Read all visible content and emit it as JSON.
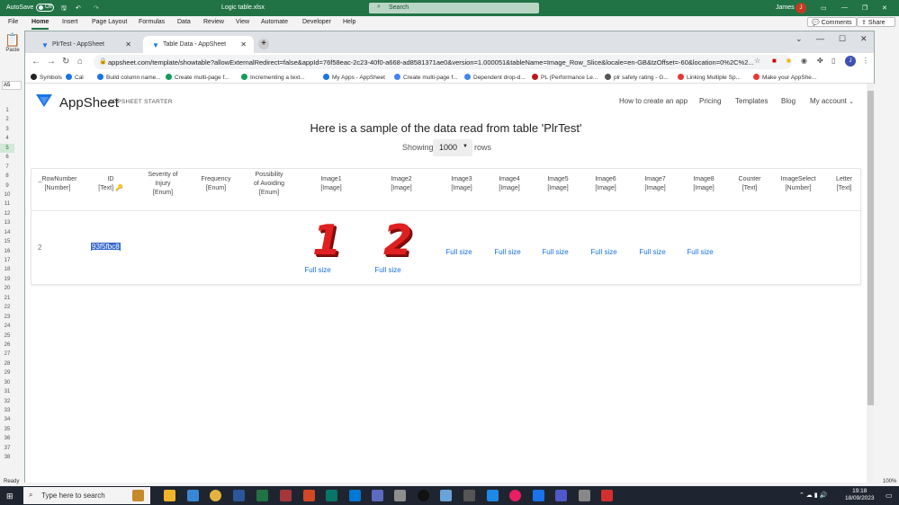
{
  "excel": {
    "autosave_label": "AutoSave",
    "autosave_state": "Off",
    "filename": "Logic table.xlsx",
    "search_placeholder": "Search",
    "user_name": "James",
    "user_initial": "J",
    "ribbon_tabs": [
      "File",
      "Home",
      "Insert",
      "Page Layout",
      "Formulas",
      "Data",
      "Review",
      "View",
      "Automate",
      "Developer",
      "Help"
    ],
    "active_tab": "Home",
    "comments_label": "Comments",
    "share_label": "Share",
    "paste_label": "Paste",
    "namebox": "A5",
    "row_numbers": [
      "1",
      "2",
      "3",
      "4",
      "5",
      "6",
      "7",
      "8",
      "9",
      "10",
      "11",
      "12",
      "13",
      "14",
      "15",
      "16",
      "17",
      "18",
      "19",
      "20",
      "21",
      "22",
      "23",
      "24",
      "25",
      "26",
      "27",
      "28",
      "29",
      "30",
      "31",
      "32",
      "33",
      "34",
      "35",
      "36",
      "37",
      "38"
    ],
    "status_left": "Ready",
    "zoom": "100%"
  },
  "chrome": {
    "tabs": [
      {
        "label": "PlrTest - AppSheet",
        "active": false
      },
      {
        "label": "Table Data - AppSheet",
        "active": true
      }
    ],
    "url": "appsheet.com/template/showtable?allowExternalRedirect=false&appId=76f58eac-2c23-40f0-a668-ad8581371ae0&version=1.000051&tableName=Image_Row_Slice&locale=en-GB&tzOffset=-60&location=0%2C%2...",
    "bookmarks": [
      "Symbols",
      "Cal",
      "Build column name...",
      "Create multi-page f...",
      "Incrementing a text...",
      "My Apps - AppSheet",
      "Create multi-page f...",
      "Dependent drop-d...",
      "PL (Performance Le...",
      "plr safety rating - G...",
      "Linking Multiple Sp...",
      "Make your AppShe..."
    ]
  },
  "appsheet": {
    "brand": "AppSheet",
    "tagline": "APPSHEET STARTER",
    "nav": [
      "How to create an app",
      "Pricing",
      "Templates",
      "Blog",
      "My account"
    ],
    "heading": "Here is a sample of the data read from table 'PlrTest'",
    "showing_label": "Showing",
    "rows_value": "1000",
    "rows_label": "rows",
    "columns": [
      {
        "name": "_RowNumber",
        "type": "[Number]"
      },
      {
        "name": "ID",
        "type": "[Text] 🔑"
      },
      {
        "name": "Severity of|Injury",
        "type": "[Enum]"
      },
      {
        "name": "Frequency",
        "type": "[Enum]"
      },
      {
        "name": "Possibility|of Avoiding",
        "type": "[Enum]"
      },
      {
        "name": "Image1",
        "type": "[Image]"
      },
      {
        "name": "Image2",
        "type": "[Image]"
      },
      {
        "name": "Image3",
        "type": "[Image]"
      },
      {
        "name": "Image4",
        "type": "[Image]"
      },
      {
        "name": "Image5",
        "type": "[Image]"
      },
      {
        "name": "Image6",
        "type": "[Image]"
      },
      {
        "name": "Image7",
        "type": "[Image]"
      },
      {
        "name": "Image8",
        "type": "[Image]"
      },
      {
        "name": "Counter",
        "type": "[Text]"
      },
      {
        "name": "ImageSelect",
        "type": "[Number]"
      },
      {
        "name": "Letter",
        "type": "[Text]"
      }
    ],
    "row": {
      "rownumber": "2",
      "id": "93f5fbc8",
      "image1_digit": "1",
      "image2_digit": "2",
      "full_size_label": "Full size"
    }
  },
  "taskbar": {
    "search_placeholder": "Type here to search",
    "time": "19:18",
    "date": "18/09/2023"
  }
}
